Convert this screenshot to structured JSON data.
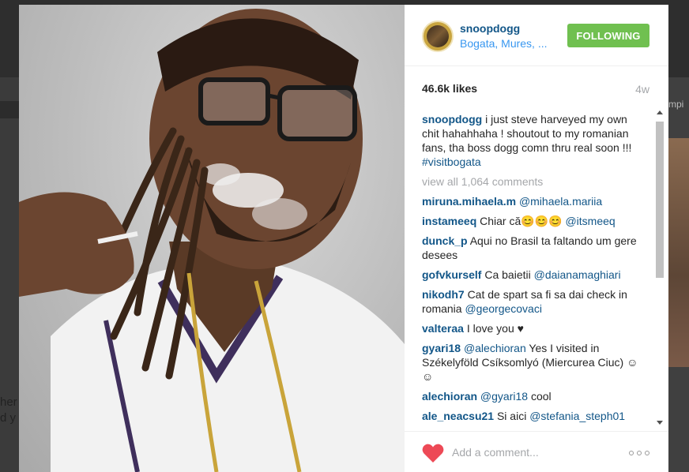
{
  "background": {
    "left_text": "her\nd y",
    "right_tag": "mpi"
  },
  "post": {
    "username": "snoopdogg",
    "location": "Bogata, Mures, ...",
    "follow_label": "FOLLOWING",
    "likes": "46.6k likes",
    "time": "4w",
    "add_comment_placeholder": "Add a comment...",
    "more_icon": "more-options-icon",
    "like_icon": "heart-icon",
    "colors": {
      "follow_button": "#70c050",
      "username": "#125688",
      "heart": "#ed4956"
    }
  },
  "caption": {
    "user": "snoopdogg",
    "text": "i just steve harveyed my own chit hahahhaha ! shoutout to my romanian fans, tha boss dogg comn thru real soon !!! ",
    "hashtag": "#visitbogata"
  },
  "view_all": "view all 1,064 comments",
  "comments": [
    {
      "user": "miruna.mihaela.m",
      "pre": "",
      "mention": "@mihaela.mariia",
      "post": ""
    },
    {
      "user": "instameeq",
      "pre": "Chiar că😊😊😊 ",
      "mention": "@itsmeeq",
      "post": ""
    },
    {
      "user": "dunck_p",
      "pre": "Aqui no Brasil ta faltando um gere desees",
      "mention": "",
      "post": ""
    },
    {
      "user": "gofvkurself",
      "pre": "Ca baietii ",
      "mention": "@daianamaghiari",
      "post": ""
    },
    {
      "user": "nikodh7",
      "pre": "Cat de spart sa fi sa dai check in romania ",
      "mention": "@georgecovaci",
      "post": ""
    },
    {
      "user": "valteraa",
      "pre": "I love you ♥",
      "mention": "",
      "post": ""
    },
    {
      "user": "gyari18",
      "pre": "",
      "mention": "@alechioran",
      "post": " Yes I visited in Székelyföld Csíksomlyó (Miercurea Ciuc) ☺☺"
    },
    {
      "user": "alechioran",
      "pre": "",
      "mention": "@gyari18",
      "post": " cool"
    },
    {
      "user": "ale_neacsu21",
      "pre": "Si aici ",
      "mention": "@stefania_steph01",
      "post": ""
    }
  ]
}
